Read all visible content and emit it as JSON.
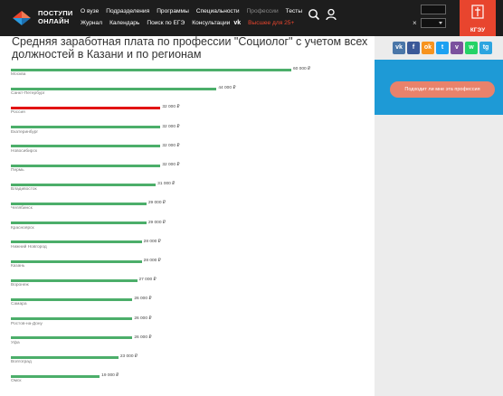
{
  "header": {
    "logo_line1": "ПОСТУПИ",
    "logo_line2": "ОНЛАЙН",
    "nav_row1": [
      {
        "label": "О вузе"
      },
      {
        "label": "Подразделения"
      },
      {
        "label": "Программы"
      },
      {
        "label": "Специальности"
      },
      {
        "label": "Профессии",
        "state": "dim"
      },
      {
        "label": "Тесты"
      }
    ],
    "nav_row2": [
      {
        "label": "Журнал"
      },
      {
        "label": "Календарь"
      },
      {
        "label": "Поиск по ЕГЭ"
      },
      {
        "label": "Консультации"
      },
      {
        "label": "Высшее для 25+",
        "state": "accent"
      }
    ],
    "vk_label": "vk",
    "close_label": "×",
    "badge_label": "КГЭУ",
    "accent_color": "#e8452e",
    "icons": [
      "search-icon",
      "user-icon",
      "close-icon",
      "chevron-down-icon"
    ]
  },
  "social": [
    {
      "name": "vk",
      "label": "vk",
      "color": "#4a76a8"
    },
    {
      "name": "facebook",
      "label": "f",
      "color": "#3b5998"
    },
    {
      "name": "odnoklassniki",
      "label": "ok",
      "color": "#f7931e"
    },
    {
      "name": "twitter",
      "label": "t",
      "color": "#1da1f2"
    },
    {
      "name": "viber",
      "label": "v",
      "color": "#7b519d"
    },
    {
      "name": "whatsapp",
      "label": "w",
      "color": "#25d366"
    },
    {
      "name": "telegram",
      "label": "tg",
      "color": "#2ca5e0"
    }
  ],
  "promo": {
    "button_label": "Подходит ли мне эта профессия",
    "bg_color": "#1e9ad6",
    "button_color": "#e9826b"
  },
  "main": {
    "title": "Средняя заработная плата по профессии \"Социолог\" с учетом всех должностей в Казани и по регионам"
  },
  "chart_data": {
    "type": "bar",
    "orientation": "horizontal",
    "unit": "₽",
    "highlight": "Россия",
    "bar_color": "#4cae6a",
    "highlight_color": "#e21414",
    "x_min": 0,
    "x_max": 60000,
    "bars": [
      {
        "city": "Москва",
        "value": 60000,
        "label": "60 000 ₽"
      },
      {
        "city": "Санкт-Петербург",
        "value": 44000,
        "label": "44 000 ₽"
      },
      {
        "city": "Россия",
        "value": 32000,
        "label": "32 000 ₽"
      },
      {
        "city": "Екатеринбург",
        "value": 32000,
        "label": "32 000 ₽"
      },
      {
        "city": "Новосибирск",
        "value": 32000,
        "label": "32 000 ₽"
      },
      {
        "city": "Пермь",
        "value": 32000,
        "label": "32 000 ₽"
      },
      {
        "city": "Владивосток",
        "value": 31000,
        "label": "31 000 ₽"
      },
      {
        "city": "Челябинск",
        "value": 29000,
        "label": "29 000 ₽"
      },
      {
        "city": "Красноярск",
        "value": 29000,
        "label": "29 000 ₽"
      },
      {
        "city": "Нижний Новгород",
        "value": 28000,
        "label": "28 000 ₽"
      },
      {
        "city": "Казань",
        "value": 28000,
        "label": "28 000 ₽"
      },
      {
        "city": "Воронеж",
        "value": 27000,
        "label": "27 000 ₽"
      },
      {
        "city": "Самара",
        "value": 26000,
        "label": "26 000 ₽"
      },
      {
        "city": "Ростов-на-Дону",
        "value": 26000,
        "label": "26 000 ₽"
      },
      {
        "city": "Уфа",
        "value": 26000,
        "label": "26 000 ₽"
      },
      {
        "city": "Волгоград",
        "value": 23000,
        "label": "23 000 ₽"
      },
      {
        "city": "Омск",
        "value": 19000,
        "label": "19 000 ₽"
      }
    ]
  }
}
